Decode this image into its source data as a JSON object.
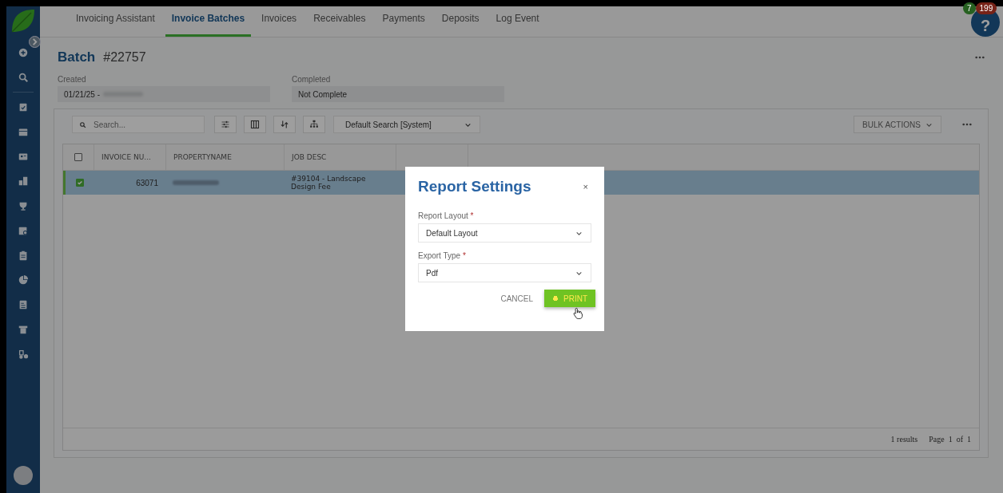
{
  "nav_tabs": [
    {
      "label": "Invoicing Assistant",
      "selected": false
    },
    {
      "label": "Invoice Batches",
      "selected": true
    },
    {
      "label": "Invoices",
      "selected": false
    },
    {
      "label": "Receivables",
      "selected": false
    },
    {
      "label": "Payments",
      "selected": false
    },
    {
      "label": "Deposits",
      "selected": false
    },
    {
      "label": "Log Event",
      "selected": false
    }
  ],
  "help": {
    "glyph": "?"
  },
  "notifications": [
    {
      "count": "7",
      "color": "#276121"
    },
    {
      "count": "199",
      "color": "#772318"
    }
  ],
  "batch": {
    "label": "Batch",
    "number": "#22757"
  },
  "fields": [
    {
      "label": "Created",
      "value": "01/21/25 -",
      "redacted": true
    },
    {
      "label": "Completed",
      "value": "Not Complete",
      "redacted": false
    }
  ],
  "toolbar": {
    "search_placeholder": "Search...",
    "saved_search": "Default Search [System]",
    "bulk_actions": "BULK ACTIONS"
  },
  "table": {
    "header_checked": false,
    "columns": [
      "INVOICE NU...",
      "PROPERTYNAME",
      "JOB DESC"
    ],
    "rows": [
      {
        "selected": true,
        "checked": true,
        "invoice_number": "63071",
        "property_redacted": true,
        "job_desc": "#39104 - Landscape Design Fee"
      }
    ]
  },
  "footer": {
    "results": "1 results",
    "page": "Page  1  of  1"
  },
  "modal": {
    "title": "Report Settings",
    "close": "×",
    "fields": [
      {
        "label": "Report Layout",
        "required_mark": "*",
        "value": "Default Layout"
      },
      {
        "label": "Export Type",
        "required_mark": "*",
        "value": "Pdf"
      }
    ],
    "buttons": [
      {
        "kind": "text",
        "label": "CANCEL"
      },
      {
        "kind": "primary",
        "label": "PRINT"
      }
    ]
  }
}
